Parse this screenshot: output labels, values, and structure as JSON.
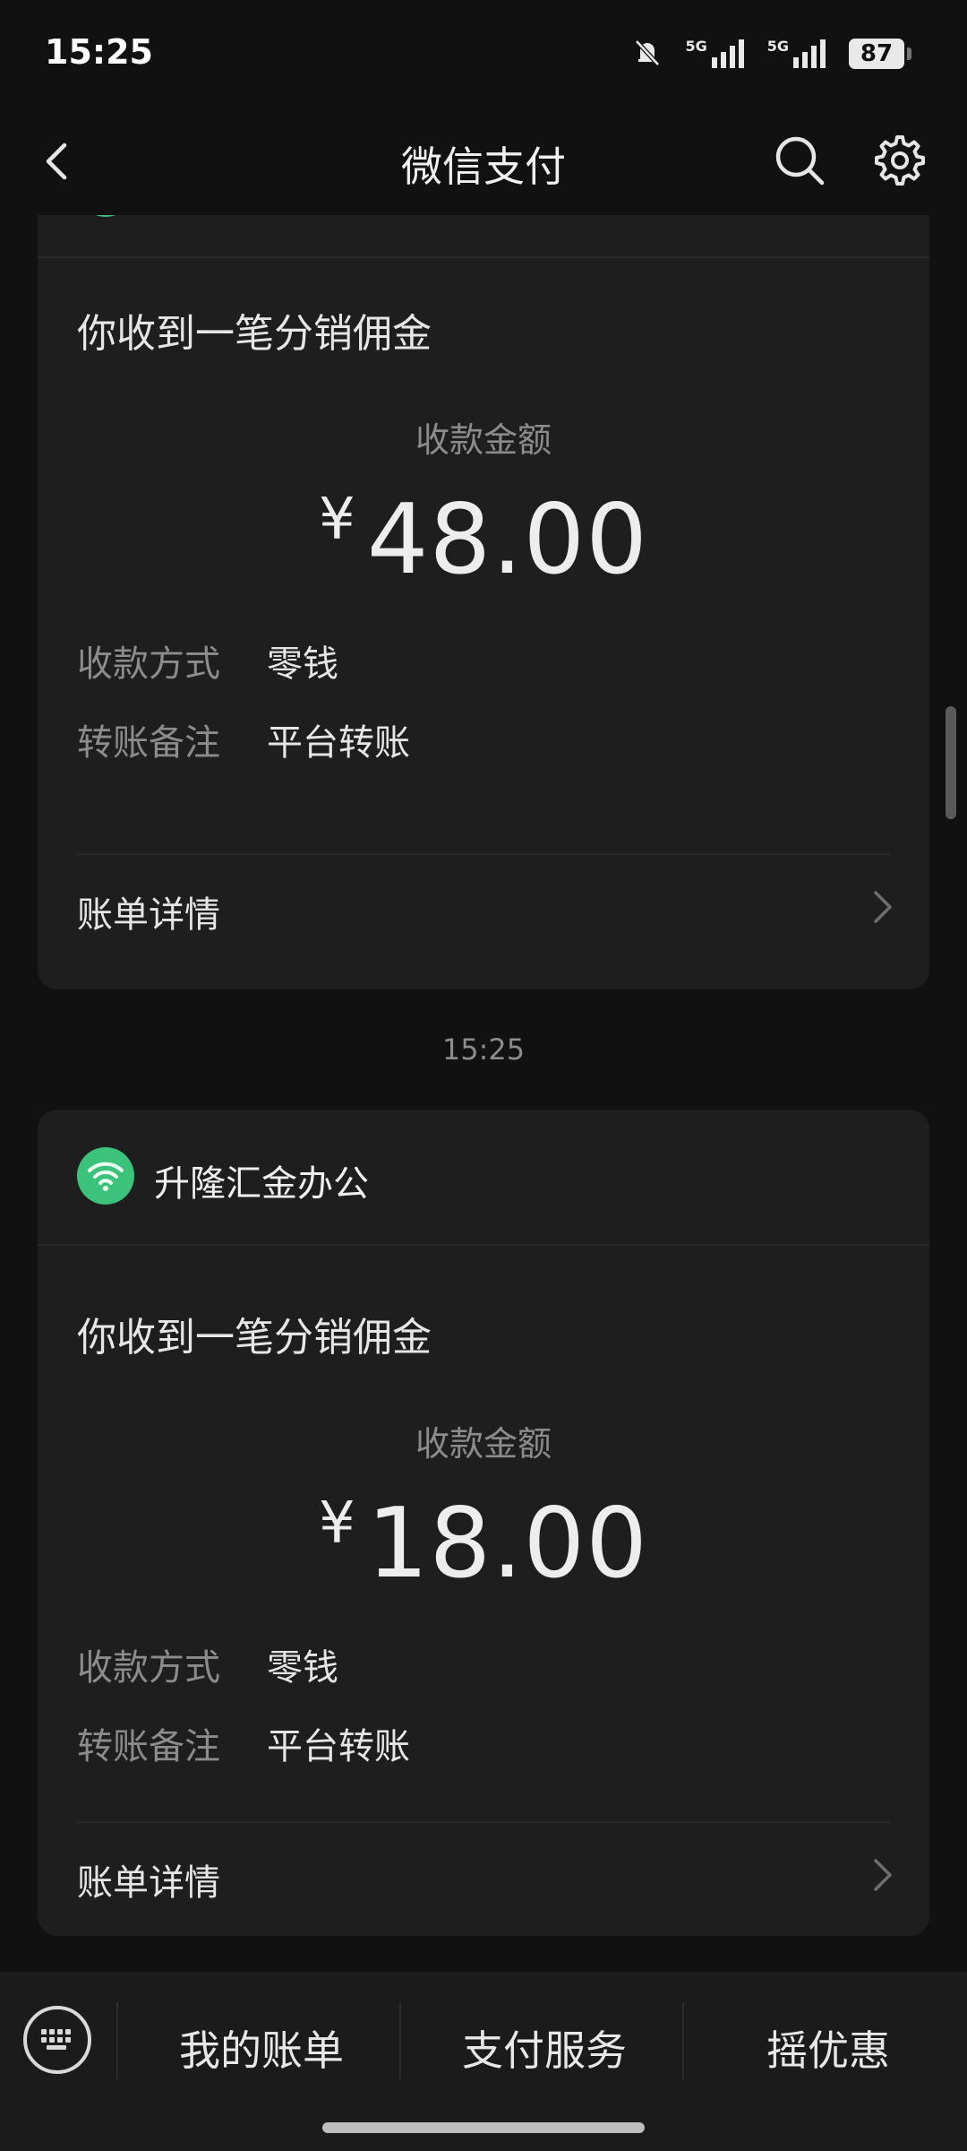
{
  "status_bar": {
    "time": "15:25",
    "network_1": "5G",
    "network_2": "5G",
    "battery": "87"
  },
  "header": {
    "title": "微信支付"
  },
  "messages": [
    {
      "title": "你收到一笔分销佣金",
      "amount_label": "收款金额",
      "currency": "¥",
      "amount": "48.00",
      "rows": [
        {
          "key": "收款方式",
          "value": "零钱"
        },
        {
          "key": "转账备注",
          "value": "平台转账"
        }
      ],
      "detail_label": "账单详情"
    },
    {
      "timestamp": "15:25",
      "merchant": "升隆汇金办公",
      "title": "你收到一笔分销佣金",
      "amount_label": "收款金额",
      "currency": "¥",
      "amount": "18.00",
      "rows": [
        {
          "key": "收款方式",
          "value": "零钱"
        },
        {
          "key": "转账备注",
          "value": "平台转账"
        }
      ],
      "detail_label": "账单详情"
    }
  ],
  "bottom_tabs": [
    {
      "label": "我的账单"
    },
    {
      "label": "支付服务"
    },
    {
      "label": "摇优惠"
    }
  ],
  "colors": {
    "background": "#111111",
    "card": "#1e1e1e",
    "accent_green": "#3cc27a"
  }
}
